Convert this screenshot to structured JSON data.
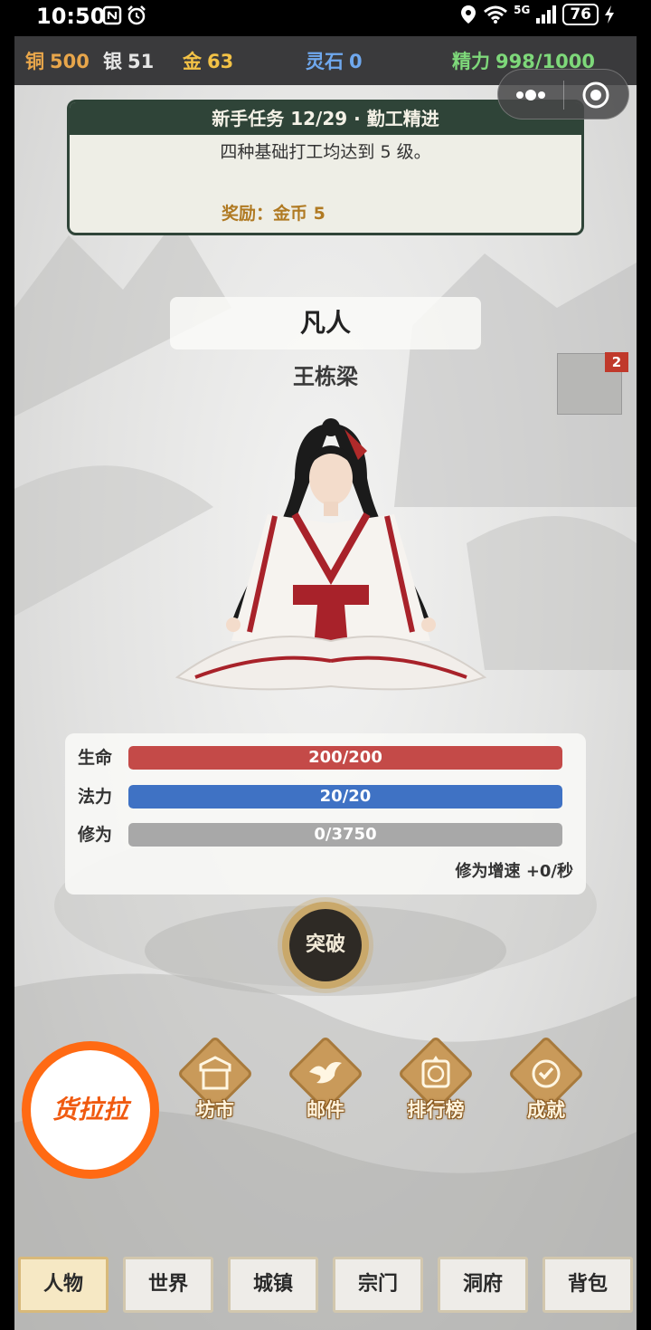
{
  "status_bar": {
    "time": "10:50",
    "battery": "76",
    "network": "5G"
  },
  "currencies": [
    {
      "label": "铜",
      "value": "500",
      "color": "#e8a64b"
    },
    {
      "label": "银",
      "value": "51",
      "color": "#e6e6e6"
    },
    {
      "label": "金",
      "value": "63",
      "color": "#f3c246"
    },
    {
      "label": "灵石",
      "value": "0",
      "color": "#6fa8ee"
    },
    {
      "label": "精力",
      "value": "998/1000",
      "color": "#7ed87a"
    }
  ],
  "quest": {
    "title": "新手任务 12/29 · 勤工精进",
    "description": "四种基础打工均达到 5 级。",
    "reward": "奖励：金币 5"
  },
  "character": {
    "realm": "凡人",
    "name": "王栋梁"
  },
  "side_badge": "2",
  "stats": {
    "hp": {
      "label": "生命",
      "text": "200/200",
      "fraction": 1.0,
      "color": "#c44a48"
    },
    "mp": {
      "label": "法力",
      "text": "20/20",
      "fraction": 1.0,
      "color": "#3f72c4"
    },
    "cultivation": {
      "label": "修为",
      "text": "0/3750",
      "fraction": 0.0,
      "color": "#a8a8a8"
    },
    "rate": "修为增速 +0/秒"
  },
  "breakthrough_label": "突破",
  "ad_label": "货拉拉",
  "functions": [
    {
      "label": "坊市",
      "icon": "market-icon"
    },
    {
      "label": "邮件",
      "icon": "dove-icon"
    },
    {
      "label": "排行榜",
      "icon": "ranking-icon"
    },
    {
      "label": "成就",
      "icon": "achievement-icon"
    }
  ],
  "nav": [
    {
      "label": "人物",
      "active": true
    },
    {
      "label": "世界",
      "active": false
    },
    {
      "label": "城镇",
      "active": false
    },
    {
      "label": "宗门",
      "active": false
    },
    {
      "label": "洞府",
      "active": false
    },
    {
      "label": "背包",
      "active": false
    }
  ]
}
